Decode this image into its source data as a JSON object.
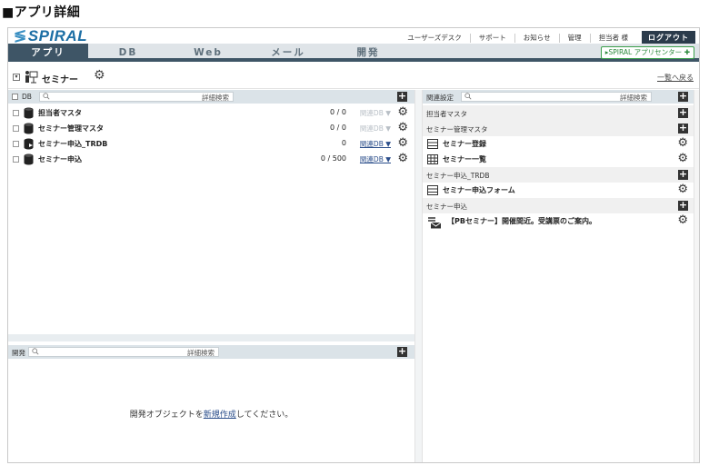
{
  "page_heading": "■アプリ詳細",
  "brand": {
    "logo_text": "SPIRAL",
    "accent": "#3e5566"
  },
  "top_links": [
    "ユーザーズデスク",
    "サポート",
    "お知らせ",
    "管理",
    "担当者 様"
  ],
  "logout_label": "ログアウト",
  "nav_tabs": [
    "アプリ",
    "DB",
    "Web",
    "メール",
    "開発"
  ],
  "app_center_label": "SPIRAL アプリセンター",
  "title_checkbox": "▾",
  "app_title": "セミナー",
  "back_link": "一覧へ戻る",
  "db_panel": {
    "label": "DB",
    "advanced_search": "詳細検索",
    "rows": [
      {
        "name": "担当者マスタ",
        "count": "0 / 0",
        "rel": "関連DB ▼",
        "rel_active": false
      },
      {
        "name": "セミナー管理マスタ",
        "count": "0 / 0",
        "rel": "関連DB ▼",
        "rel_active": false
      },
      {
        "name": "セミナー申込_TRDB",
        "count": "0",
        "rel": "関連DB ▼",
        "rel_active": true
      },
      {
        "name": "セミナー申込",
        "count": "0 / 500",
        "rel": "関連DB ▼",
        "rel_active": true
      }
    ]
  },
  "related_panel": {
    "label": "関連設定",
    "advanced_search": "詳細検索",
    "groups": [
      {
        "name": "担当者マスタ",
        "items": []
      },
      {
        "name": "セミナー管理マスタ",
        "items": [
          {
            "name": "セミナー登録",
            "icon": "form-icon"
          },
          {
            "name": "セミナー一覧",
            "icon": "grid-icon"
          }
        ]
      },
      {
        "name": "セミナー申込_TRDB",
        "items": [
          {
            "name": "セミナー申込フォーム",
            "icon": "form-icon"
          }
        ]
      },
      {
        "name": "セミナー申込",
        "items": [
          {
            "name": "【PBセミナー】開催間近。受講票のご案内。",
            "icon": "mail-icon"
          }
        ]
      }
    ]
  },
  "dev_panel": {
    "label": "開発",
    "advanced_search": "詳細検索",
    "message_before": "開発オブジェクトを",
    "message_link": "新規作成",
    "message_after": "してください。"
  }
}
